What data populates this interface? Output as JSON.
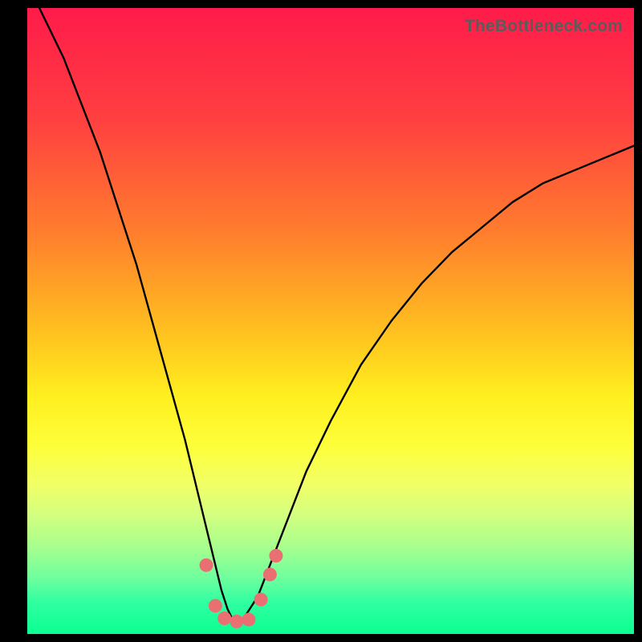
{
  "watermark": "TheBottleneck.com",
  "chart_data": {
    "type": "line",
    "title": "",
    "xlabel": "",
    "ylabel": "",
    "xlim": [
      0,
      100
    ],
    "ylim": [
      0,
      100
    ],
    "series": [
      {
        "name": "bottleneck-curve",
        "x": [
          2,
          4,
          6,
          8,
          10,
          12,
          14,
          16,
          18,
          20,
          22,
          24,
          26,
          28,
          30,
          32,
          33,
          34,
          35,
          36,
          38,
          40,
          42,
          44,
          46,
          50,
          55,
          60,
          65,
          70,
          75,
          80,
          85,
          90,
          95,
          100
        ],
        "y": [
          100,
          96,
          92,
          87,
          82,
          77,
          71,
          65,
          59,
          52,
          45,
          38,
          31,
          23,
          15,
          7,
          4,
          2,
          2,
          3,
          6,
          11,
          16,
          21,
          26,
          34,
          43,
          50,
          56,
          61,
          65,
          69,
          72,
          74,
          76,
          78
        ]
      }
    ],
    "markers": {
      "name": "highlight-dots",
      "color": "#e96f72",
      "points": [
        {
          "x": 29.5,
          "y": 11
        },
        {
          "x": 31.0,
          "y": 4.5
        },
        {
          "x": 32.5,
          "y": 2.5
        },
        {
          "x": 34.5,
          "y": 2.0
        },
        {
          "x": 36.5,
          "y": 2.3
        },
        {
          "x": 38.5,
          "y": 5.5
        },
        {
          "x": 40.0,
          "y": 9.5
        },
        {
          "x": 41.0,
          "y": 12.5
        }
      ]
    },
    "gradient_stops": [
      {
        "pct": 0,
        "color": "#ff1b4a"
      },
      {
        "pct": 18,
        "color": "#ff4040"
      },
      {
        "pct": 36,
        "color": "#ff7e2d"
      },
      {
        "pct": 52,
        "color": "#ffc21f"
      },
      {
        "pct": 62,
        "color": "#ffef1f"
      },
      {
        "pct": 70,
        "color": "#fdff3a"
      },
      {
        "pct": 76,
        "color": "#f2ff66"
      },
      {
        "pct": 81,
        "color": "#d3ff80"
      },
      {
        "pct": 86,
        "color": "#a8ff8d"
      },
      {
        "pct": 91,
        "color": "#6fff9e"
      },
      {
        "pct": 95,
        "color": "#2fffa0"
      },
      {
        "pct": 100,
        "color": "#0cff93"
      }
    ]
  }
}
